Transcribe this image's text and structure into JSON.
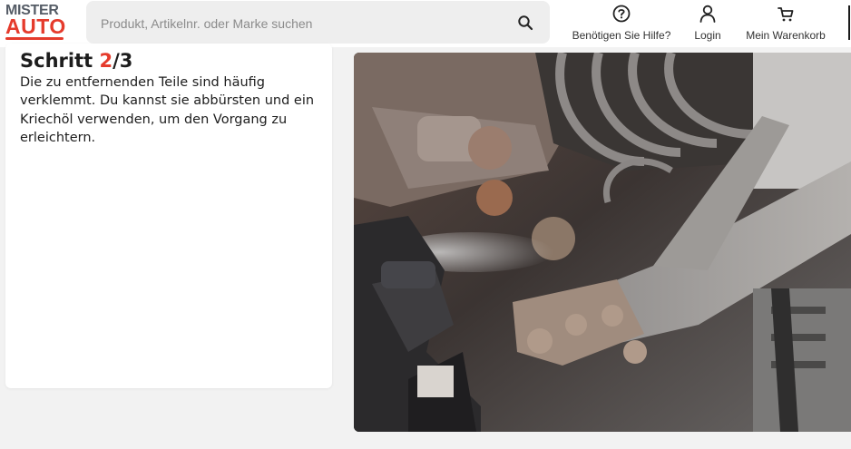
{
  "header": {
    "logo": {
      "line1": "MISTER",
      "line2": "AUTO"
    },
    "search": {
      "placeholder": "Produkt, Artikelnr. oder Marke suchen",
      "value": ""
    },
    "help_label": "Benötigen Sie Hilfe?",
    "login_label": "Login",
    "cart_label": "Mein Warenkorb"
  },
  "step": {
    "prefix": "Schritt ",
    "current": "2",
    "total": "/3",
    "text": "Die zu entfernenden Teile sind häufig verklemmt. Du kannst sie abbürsten und ein Kriechöl verwenden, um den Vorgang zu erleichtern."
  },
  "colors": {
    "brand_red": "#e53b2c",
    "logo_gray": "#555c66",
    "search_bg": "#eeeeee",
    "page_bg": "#f2f2f2"
  },
  "icons": {
    "search": "search-icon",
    "help": "question-circle-icon",
    "login": "user-icon",
    "cart": "cart-icon"
  }
}
